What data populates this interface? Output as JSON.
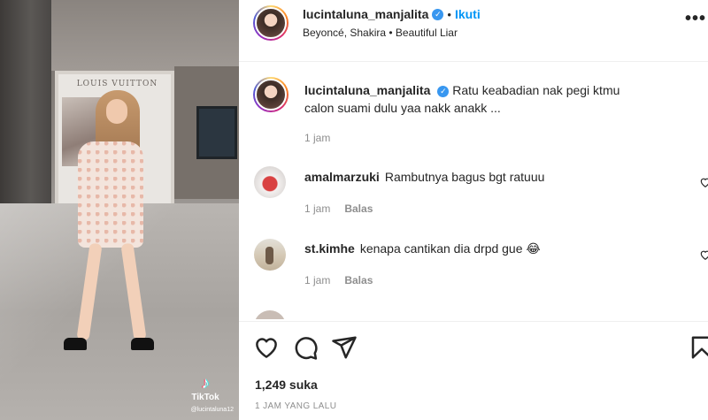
{
  "post": {
    "username": "lucintaluna_manjalita",
    "follow_label": "Ikuti",
    "audio": "Beyoncé, Shakira • Beautiful Liar",
    "caption": "Ratu keabadian nak pegi ktmu calon suami dulu yaa nakk anakk ...",
    "caption_time": "1 jam",
    "likes": "1,249 suka",
    "timestamp": "1 JAM YANG LALU"
  },
  "media": {
    "store_sign": "LOUIS VUITTON",
    "tiktok_brand": "TikTok",
    "tiktok_handle": "@lucintaluna12"
  },
  "comments": [
    {
      "username": "amalmarzuki",
      "text": "Rambutnya bagus bgt ratuuu",
      "time": "1 jam",
      "reply_label": "Balas"
    },
    {
      "username": "st.kimhe",
      "text": "kenapa cantikan dia drpd gue 😂",
      "time": "1 jam",
      "reply_label": "Balas"
    }
  ],
  "icons": {
    "verified": "verified-badge-icon",
    "more": "more-options-icon",
    "like": "heart-icon",
    "comment": "comment-icon",
    "share": "share-icon",
    "save": "bookmark-icon",
    "music": "tiktok-icon"
  },
  "colors": {
    "accent": "#0095f6",
    "verified": "#3897f0",
    "text": "#262626",
    "muted": "#8e8e8e"
  }
}
